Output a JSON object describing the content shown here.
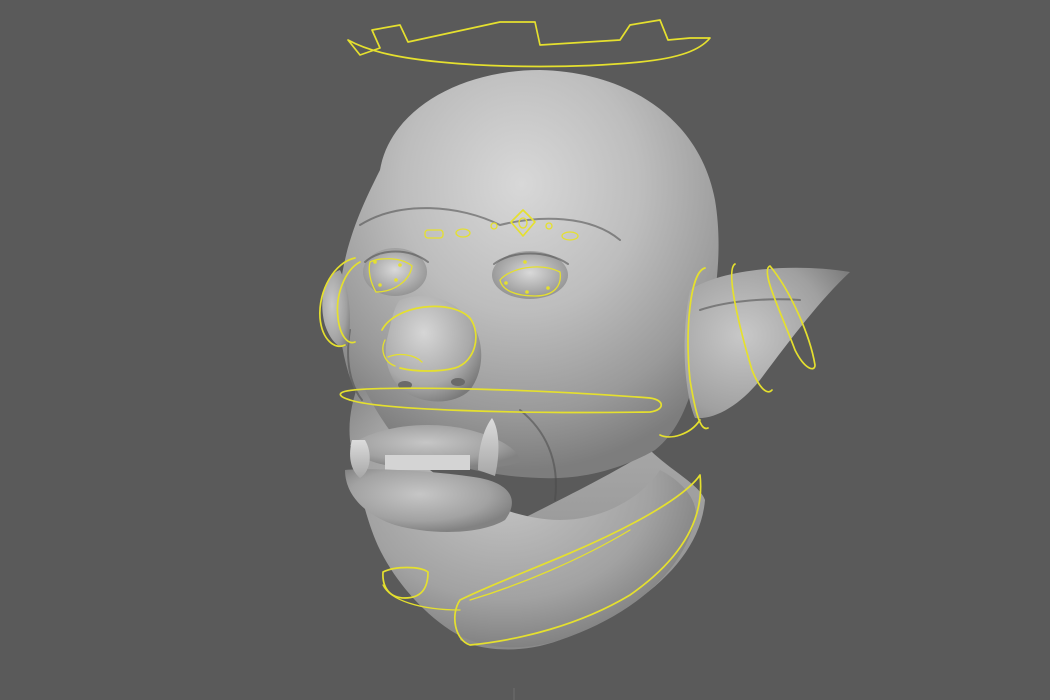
{
  "scene": {
    "subject": "sculpted-orc-head",
    "colors": {
      "background": "#5a5a5a",
      "mesh_light": "#c9c9c9",
      "mesh_mid": "#a8a8a8",
      "mesh_dark": "#6f6f6f",
      "rig_control": "#e5e02e",
      "tooth": "#d4d4d4"
    }
  }
}
